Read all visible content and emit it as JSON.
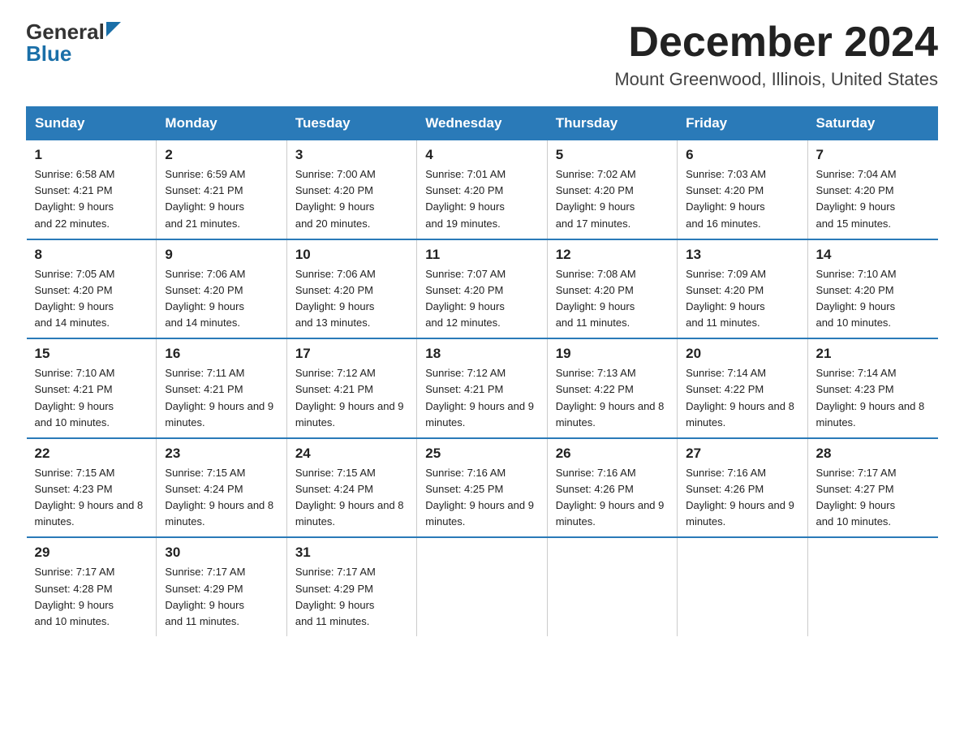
{
  "header": {
    "logo_general": "General",
    "logo_blue": "Blue",
    "month_title": "December 2024",
    "location": "Mount Greenwood, Illinois, United States"
  },
  "days_of_week": [
    "Sunday",
    "Monday",
    "Tuesday",
    "Wednesday",
    "Thursday",
    "Friday",
    "Saturday"
  ],
  "weeks": [
    [
      {
        "day": "1",
        "sunrise": "6:58 AM",
        "sunset": "4:21 PM",
        "daylight": "9 hours and 22 minutes."
      },
      {
        "day": "2",
        "sunrise": "6:59 AM",
        "sunset": "4:21 PM",
        "daylight": "9 hours and 21 minutes."
      },
      {
        "day": "3",
        "sunrise": "7:00 AM",
        "sunset": "4:20 PM",
        "daylight": "9 hours and 20 minutes."
      },
      {
        "day": "4",
        "sunrise": "7:01 AM",
        "sunset": "4:20 PM",
        "daylight": "9 hours and 19 minutes."
      },
      {
        "day": "5",
        "sunrise": "7:02 AM",
        "sunset": "4:20 PM",
        "daylight": "9 hours and 17 minutes."
      },
      {
        "day": "6",
        "sunrise": "7:03 AM",
        "sunset": "4:20 PM",
        "daylight": "9 hours and 16 minutes."
      },
      {
        "day": "7",
        "sunrise": "7:04 AM",
        "sunset": "4:20 PM",
        "daylight": "9 hours and 15 minutes."
      }
    ],
    [
      {
        "day": "8",
        "sunrise": "7:05 AM",
        "sunset": "4:20 PM",
        "daylight": "9 hours and 14 minutes."
      },
      {
        "day": "9",
        "sunrise": "7:06 AM",
        "sunset": "4:20 PM",
        "daylight": "9 hours and 14 minutes."
      },
      {
        "day": "10",
        "sunrise": "7:06 AM",
        "sunset": "4:20 PM",
        "daylight": "9 hours and 13 minutes."
      },
      {
        "day": "11",
        "sunrise": "7:07 AM",
        "sunset": "4:20 PM",
        "daylight": "9 hours and 12 minutes."
      },
      {
        "day": "12",
        "sunrise": "7:08 AM",
        "sunset": "4:20 PM",
        "daylight": "9 hours and 11 minutes."
      },
      {
        "day": "13",
        "sunrise": "7:09 AM",
        "sunset": "4:20 PM",
        "daylight": "9 hours and 11 minutes."
      },
      {
        "day": "14",
        "sunrise": "7:10 AM",
        "sunset": "4:20 PM",
        "daylight": "9 hours and 10 minutes."
      }
    ],
    [
      {
        "day": "15",
        "sunrise": "7:10 AM",
        "sunset": "4:21 PM",
        "daylight": "9 hours and 10 minutes."
      },
      {
        "day": "16",
        "sunrise": "7:11 AM",
        "sunset": "4:21 PM",
        "daylight": "9 hours and 9 minutes."
      },
      {
        "day": "17",
        "sunrise": "7:12 AM",
        "sunset": "4:21 PM",
        "daylight": "9 hours and 9 minutes."
      },
      {
        "day": "18",
        "sunrise": "7:12 AM",
        "sunset": "4:21 PM",
        "daylight": "9 hours and 9 minutes."
      },
      {
        "day": "19",
        "sunrise": "7:13 AM",
        "sunset": "4:22 PM",
        "daylight": "9 hours and 8 minutes."
      },
      {
        "day": "20",
        "sunrise": "7:14 AM",
        "sunset": "4:22 PM",
        "daylight": "9 hours and 8 minutes."
      },
      {
        "day": "21",
        "sunrise": "7:14 AM",
        "sunset": "4:23 PM",
        "daylight": "9 hours and 8 minutes."
      }
    ],
    [
      {
        "day": "22",
        "sunrise": "7:15 AM",
        "sunset": "4:23 PM",
        "daylight": "9 hours and 8 minutes."
      },
      {
        "day": "23",
        "sunrise": "7:15 AM",
        "sunset": "4:24 PM",
        "daylight": "9 hours and 8 minutes."
      },
      {
        "day": "24",
        "sunrise": "7:15 AM",
        "sunset": "4:24 PM",
        "daylight": "9 hours and 8 minutes."
      },
      {
        "day": "25",
        "sunrise": "7:16 AM",
        "sunset": "4:25 PM",
        "daylight": "9 hours and 9 minutes."
      },
      {
        "day": "26",
        "sunrise": "7:16 AM",
        "sunset": "4:26 PM",
        "daylight": "9 hours and 9 minutes."
      },
      {
        "day": "27",
        "sunrise": "7:16 AM",
        "sunset": "4:26 PM",
        "daylight": "9 hours and 9 minutes."
      },
      {
        "day": "28",
        "sunrise": "7:17 AM",
        "sunset": "4:27 PM",
        "daylight": "9 hours and 10 minutes."
      }
    ],
    [
      {
        "day": "29",
        "sunrise": "7:17 AM",
        "sunset": "4:28 PM",
        "daylight": "9 hours and 10 minutes."
      },
      {
        "day": "30",
        "sunrise": "7:17 AM",
        "sunset": "4:29 PM",
        "daylight": "9 hours and 11 minutes."
      },
      {
        "day": "31",
        "sunrise": "7:17 AM",
        "sunset": "4:29 PM",
        "daylight": "9 hours and 11 minutes."
      },
      null,
      null,
      null,
      null
    ]
  ],
  "labels": {
    "sunrise": "Sunrise: ",
    "sunset": "Sunset: ",
    "daylight": "Daylight: "
  }
}
